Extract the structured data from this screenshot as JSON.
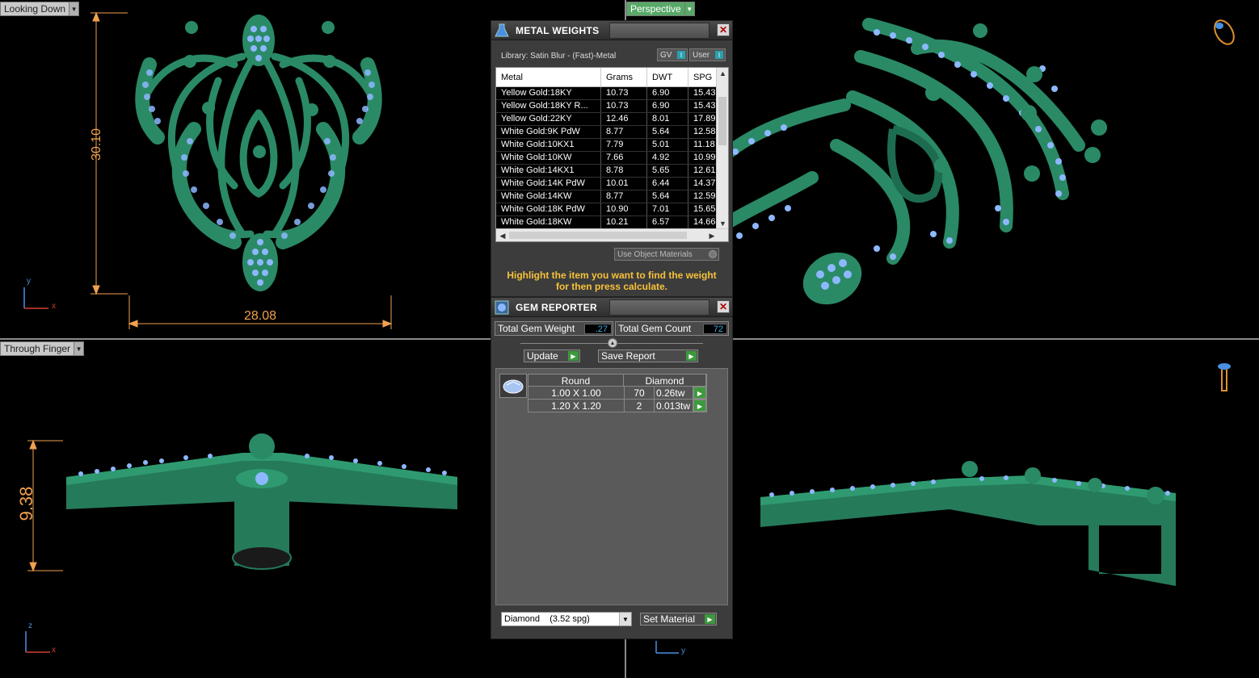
{
  "viewports": {
    "top_left": {
      "label": "Looking Down",
      "dim_height": "30.10",
      "dim_width": "28.08",
      "axis_v": "y",
      "axis_h": "x"
    },
    "top_right": {
      "label": "Perspective"
    },
    "bottom_left": {
      "label": "Through Finger",
      "dim_height": "9.38",
      "axis_v": "z",
      "axis_h": "x"
    },
    "bottom_right": {
      "axis_h": "y"
    }
  },
  "metal_weights": {
    "title": "METAL WEIGHTS",
    "library": "Library: Satin Blur - (Fast)-Metal",
    "gv_label": "GV",
    "user_label": "User",
    "columns": [
      "Metal",
      "Grams",
      "DWT",
      "SPG"
    ],
    "rows": [
      [
        "Yellow Gold:18KY",
        "10.73",
        "6.90",
        "15.43"
      ],
      [
        "Yellow Gold:18KY R...",
        "10.73",
        "6.90",
        "15.43"
      ],
      [
        "Yellow Gold:22KY",
        "12.46",
        "8.01",
        "17.89"
      ],
      [
        "White Gold:9K PdW",
        "8.77",
        "5.64",
        "12.58"
      ],
      [
        "White Gold:10KX1",
        "7.79",
        "5.01",
        "11.18"
      ],
      [
        "White Gold:10KW",
        "7.66",
        "4.92",
        "10.99"
      ],
      [
        "White Gold:14KX1",
        "8.78",
        "5.65",
        "12.61"
      ],
      [
        "White Gold:14K PdW",
        "10.01",
        "6.44",
        "14.37"
      ],
      [
        "White Gold:14KW",
        "8.77",
        "5.64",
        "12.59"
      ],
      [
        "White Gold:18K PdW",
        "10.90",
        "7.01",
        "15.65"
      ],
      [
        "White Gold:18KW",
        "10.21",
        "6.57",
        "14.66"
      ]
    ],
    "use_object_materials": "Use Object Materials",
    "hint_line1": "Highlight the item you want to find the weight",
    "hint_line2": "for then press calculate."
  },
  "gem_reporter": {
    "title": "GEM REPORTER",
    "total_weight_label": "Total Gem Weight",
    "total_weight_value": ".27",
    "total_count_label": "Total Gem Count",
    "total_count_value": "72",
    "update_label": "Update",
    "save_report_label": "Save Report",
    "table_headers": [
      "Round",
      "Diamond"
    ],
    "rows": [
      {
        "size": "1.00 X 1.00",
        "count": "70",
        "weight": "0.26tw"
      },
      {
        "size": "1.20 X 1.20",
        "count": "2",
        "weight": "0.013tw"
      }
    ],
    "material_select": "Diamond    (3.52 spg)",
    "set_material_label": "Set Material"
  },
  "colors": {
    "metal": "#2a8a66",
    "gem": "#8db8ff",
    "dimension": "#f0a050",
    "hint": "#f7c23a"
  }
}
